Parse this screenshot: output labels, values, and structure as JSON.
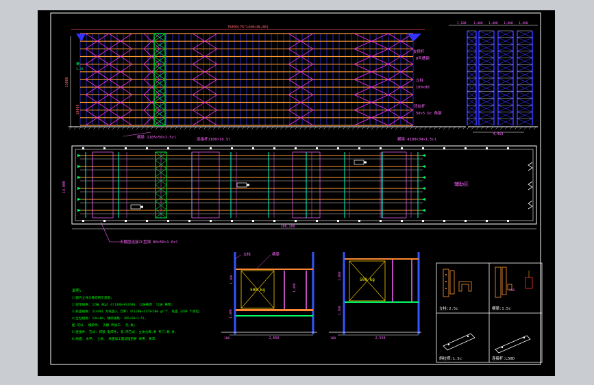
{
  "colors": {
    "background": "#000000",
    "frame": "#ffffff",
    "beam": "#ff9933",
    "brace": "#ff33ff",
    "upright": "#3333ff",
    "tie": "#00ffcc",
    "text_label": "#ff66ff",
    "text_note": "#00ff00",
    "dim": "#ffffff",
    "green_column": "#00cc33"
  },
  "elevation": {
    "top_dim": "78400(76°1440×48,80)",
    "height_dim_outer": "11000",
    "height_dim_inner": "10000",
    "label_beam": "横梁 1105×50×1.5cl",
    "label_tie": "连接杆1100×16.5l",
    "label_brace": "支撑杆",
    "label_brace_sub": "8号槽钢",
    "label_upright": "立柱",
    "label_upright_sub": "100×80",
    "label_pull": "背拉杆",
    "label_pull_sub": "50×5 Dc 角钢",
    "label_left_top": "横",
    "label_left_sub": "1.4l"
  },
  "side_view": {
    "dims": [
      "1,100",
      "1,400",
      "1,400",
      "1,400",
      "1,400"
    ],
    "width_dim": "4,450",
    "label_beam": "横梁 4180×34×1.5cl"
  },
  "plan": {
    "length_dim": "100,100",
    "depth_dim": "14,000",
    "area_label": "辅助区",
    "label_tie": "天棚层连接IC型钢 80×50×1.0cl"
  },
  "detail_a": {
    "label_upright": "立柱",
    "label_beam": "横梁",
    "load": "500 kg",
    "dims": [
      "1,100",
      "1,400",
      "1,400"
    ],
    "width_dim": "2,650",
    "base_dim": "100"
  },
  "detail_b": {
    "load": "500 kg",
    "dims": [
      "1,000",
      "1,100"
    ],
    "width_dim": "2,550",
    "base_dim": "100"
  },
  "notes": {
    "title": "说明:",
    "lines": [
      "1)图为立体仓库结构示意图;",
      "2)货架规格: 12层 4Kgt 4l1300×0l2600, 12层载荷, 11层.重物;",
      "3)托盘规格: 11440l 为托盘入 万库l 4l1200×1174×500 gl°f, 托盘 3200 个货位;",
      "4)立柱规格: 144×80, 横梁规格: 105×50×1.5l,",
      "   配.可以、 横梁件、 天棚.件加工、 托.板;",
      "5)连接件. 方式: 焊接 电焊件, 安.所方式: 立体仓库.要 专门.要.并.",
      "6)地面. 水平、 土地、 地面加工面处理后要 采用. 要求."
    ]
  },
  "parts": {
    "upright": "立柱:2.5c",
    "beam": "横梁:1.5c",
    "beam_dim": "150",
    "brace": "斜拉撑:1.5c",
    "tie": "连接杆:L50D"
  }
}
